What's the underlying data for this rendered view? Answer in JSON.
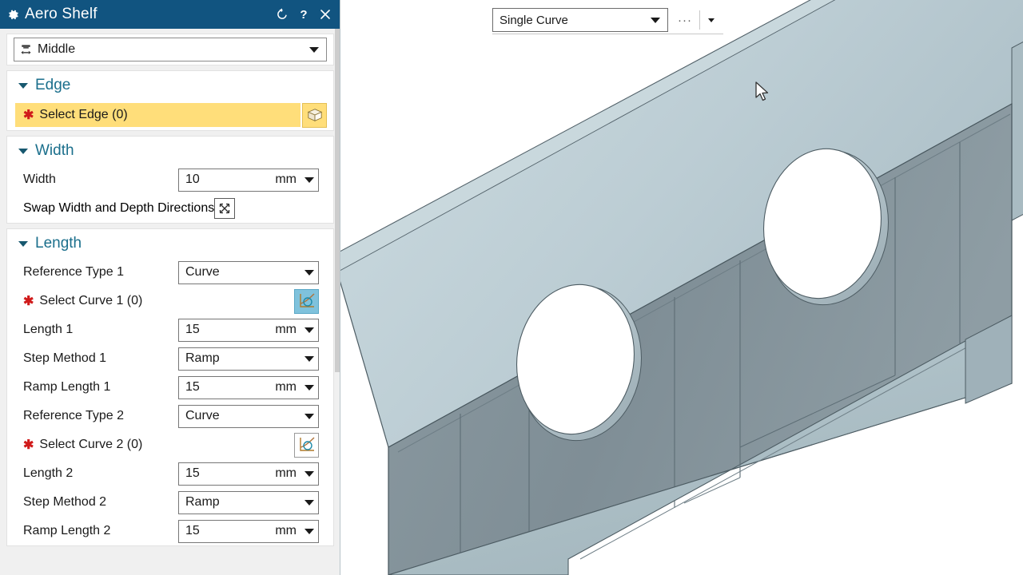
{
  "window": {
    "title": "Aero Shelf",
    "icons": {
      "settings": "gear-icon",
      "reset": "reset-icon",
      "help": "help-icon",
      "close": "close-icon"
    }
  },
  "viewport": {
    "toolbar": {
      "mode_value": "Single Curve",
      "more_label": "···"
    },
    "model": {
      "name": "channel-beam-with-holes",
      "face_light": "#c2d2d8",
      "face_top": "#b6c8ce",
      "face_web": "#7f8f97",
      "face_mid": "#97a6ad",
      "edge": "#46555c",
      "hole_fill": "#ffffff"
    },
    "background": "#ffffff"
  },
  "panel": {
    "selection": {
      "icon": "align-middle-icon",
      "value": "Middle"
    },
    "sections": [
      {
        "id": "edge",
        "title": "Edge",
        "expanded": true,
        "select_edge": {
          "required_mark": "✱",
          "label": "Select Edge (0)",
          "icon": "box-select-icon",
          "highlight_color": "#ffde7a"
        }
      },
      {
        "id": "width",
        "title": "Width",
        "expanded": true,
        "rows": [
          {
            "label": "Width",
            "value": "10",
            "unit": "mm",
            "type": "value-field"
          },
          {
            "label": "Swap Width and Depth Directions",
            "type": "toggle-button",
            "icon": "swap-arrows-icon"
          }
        ]
      },
      {
        "id": "length",
        "title": "Length",
        "expanded": true,
        "rows": [
          {
            "label": "Reference Type 1",
            "value": "Curve",
            "type": "dropdown"
          },
          {
            "label": "Select Curve 1 (0)",
            "required_mark": "✱",
            "type": "select-button",
            "icon": "curve-select-icon",
            "active": true
          },
          {
            "label": "Length 1",
            "value": "15",
            "unit": "mm",
            "type": "value-field"
          },
          {
            "label": "Step Method 1",
            "value": "Ramp",
            "type": "dropdown"
          },
          {
            "label": "Ramp Length 1",
            "value": "15",
            "unit": "mm",
            "type": "value-field"
          },
          {
            "label": "Reference Type 2",
            "value": "Curve",
            "type": "dropdown"
          },
          {
            "label": "Select Curve 2 (0)",
            "required_mark": "✱",
            "type": "select-button",
            "icon": "curve-select-icon",
            "active": false
          },
          {
            "label": "Length 2",
            "value": "15",
            "unit": "mm",
            "type": "value-field"
          },
          {
            "label": "Step Method 2",
            "value": "Ramp",
            "type": "dropdown"
          },
          {
            "label": "Ramp Length 2",
            "value": "15",
            "unit": "mm",
            "type": "value-field"
          }
        ]
      }
    ]
  },
  "colors": {
    "titlebar": "#115480",
    "section_title": "#1b6f8c",
    "required": "#d01a1a",
    "highlight": "#ffde7a",
    "active_button": "#7fc2dc",
    "panel_bg": "#f0f0f0"
  }
}
